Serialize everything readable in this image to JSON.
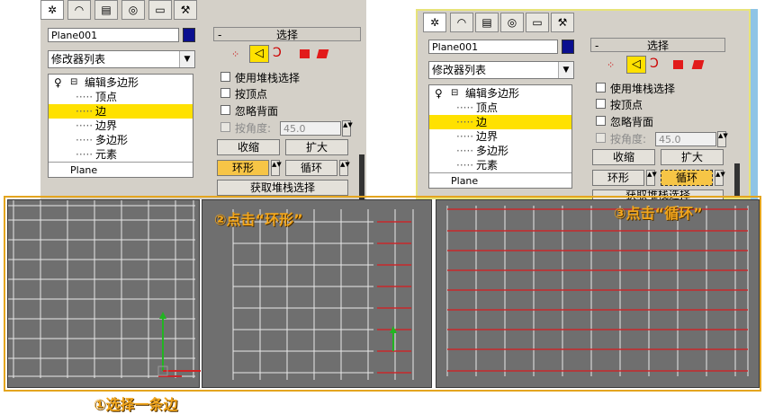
{
  "left_panel": {
    "object_name": "Plane001",
    "modifier_list": "修改器列表",
    "stack": {
      "root": "编辑多边形",
      "items": [
        "顶点",
        "边",
        "边界",
        "多边形",
        "元素"
      ],
      "selected": "边",
      "base": "Plane"
    },
    "selection": {
      "title": "选择",
      "use_stack": "使用堆栈选择",
      "by_vertex": "按顶点",
      "ignore_backfacing": "忽略背面",
      "by_angle": "按角度:",
      "angle_value": "45.0",
      "shrink": "收缩",
      "grow": "扩大",
      "ring": "环形",
      "loop": "循环",
      "get_stack": "获取堆栈选择"
    }
  },
  "right_panel": {
    "object_name": "Plane001",
    "modifier_list": "修改器列表",
    "stack": {
      "root": "编辑多边形",
      "items": [
        "顶点",
        "边",
        "边界",
        "多边形",
        "元素"
      ],
      "selected": "边",
      "base": "Plane"
    },
    "selection": {
      "title": "选择",
      "use_stack": "使用堆栈选择",
      "by_vertex": "按顶点",
      "ignore_backfacing": "忽略背面",
      "by_angle": "按角度:",
      "angle_value": "45.0",
      "shrink": "收缩",
      "grow": "扩大",
      "ring": "环形",
      "loop": "循环",
      "get_stack": "获取堆栈选择"
    }
  },
  "annotations": {
    "step1": "①选择一条边",
    "step2": "②点击“环形”",
    "step3": "③点击“循环”"
  },
  "colors": {
    "viewport_bg": "#6f6f6f",
    "grid": "#e9e9e9",
    "selected_edge": "#c8282c",
    "highlight": "#ffe100",
    "annotation": "#f2a61c",
    "frame": "#e4a51f"
  },
  "icons": [
    "modify-tab-icon",
    "create-tab-icon",
    "hierarchy-tab-icon",
    "motion-tab-icon",
    "display-tab-icon",
    "utilities-tab-icon"
  ]
}
